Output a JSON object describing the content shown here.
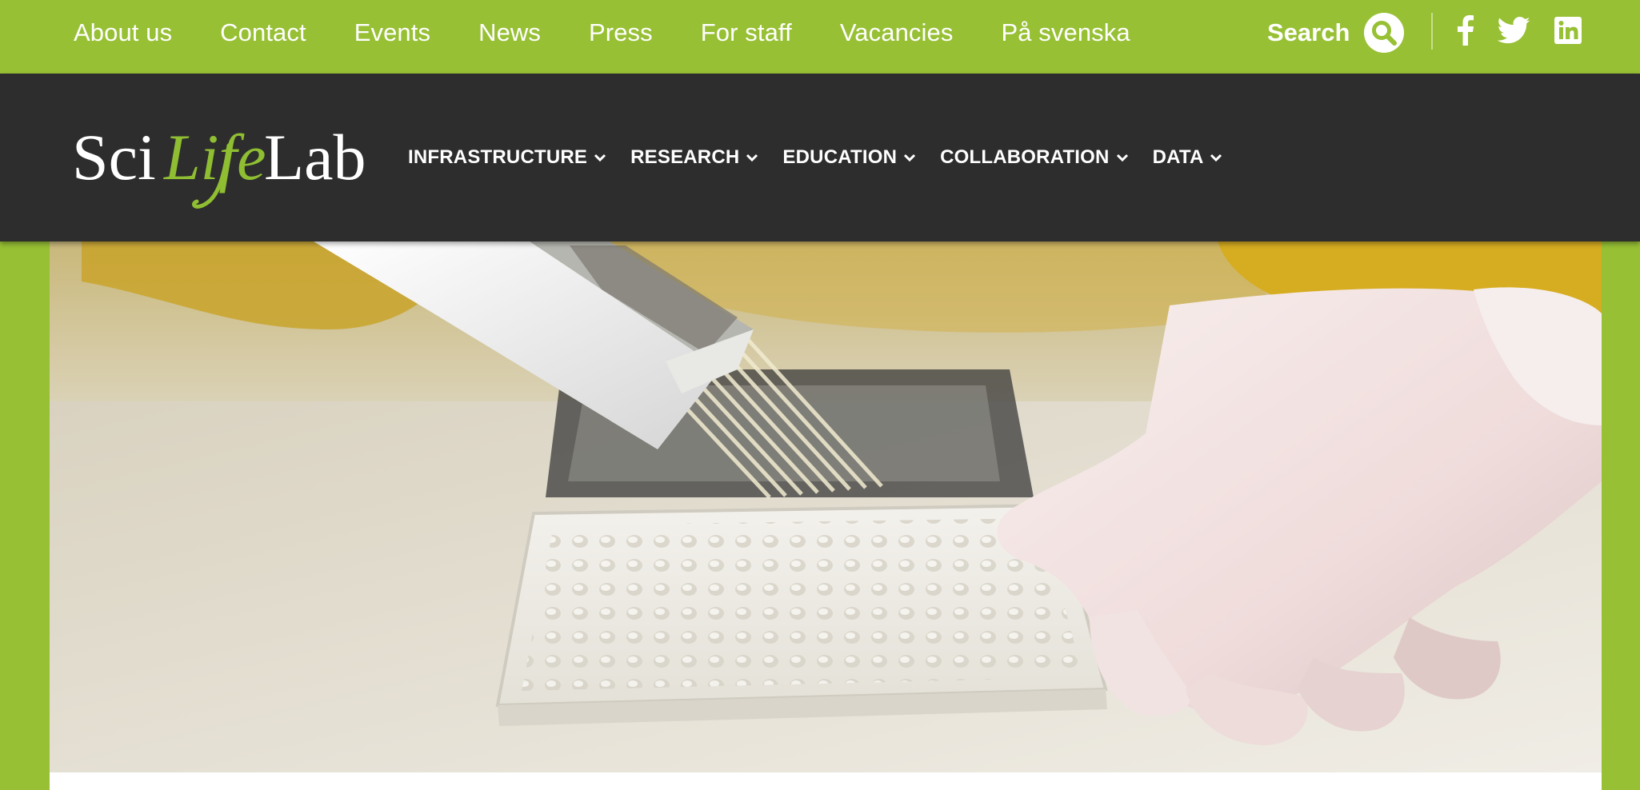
{
  "topnav": {
    "links": [
      "About us",
      "Contact",
      "Events",
      "News",
      "Press",
      "For staff",
      "Vacancies",
      "På svenska"
    ]
  },
  "search": {
    "label": "Search",
    "icon": "search-icon"
  },
  "social": [
    "facebook-icon",
    "twitter-icon",
    "linkedin-icon"
  ],
  "brand": {
    "logo_text": "SciLifeLab",
    "colors": {
      "green": "#97c034",
      "dark": "#2d2d2d",
      "white": "#ffffff"
    }
  },
  "mainnav": {
    "items": [
      "INFRASTRUCTURE",
      "RESEARCH",
      "EDUCATION",
      "COLLABORATION",
      "DATA"
    ]
  },
  "hero": {
    "icon": "lab-pipette-photo"
  }
}
